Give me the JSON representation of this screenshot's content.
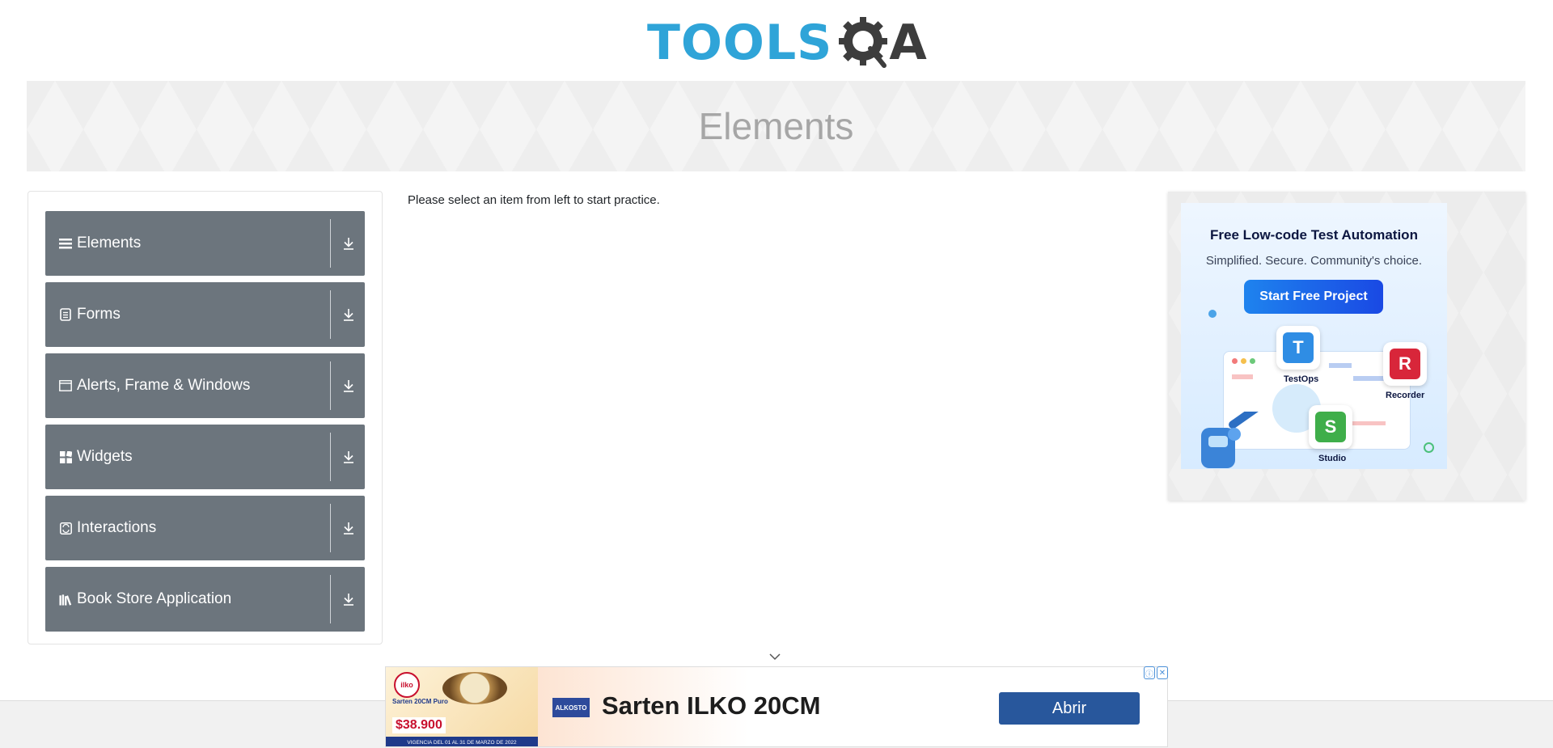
{
  "header": {
    "logo_tools": "TOOLS",
    "logo_a": "A",
    "page_title": "Elements"
  },
  "sidebar": {
    "groups": [
      {
        "label": "Elements",
        "icon": "list-icon"
      },
      {
        "label": "Forms",
        "icon": "form-icon"
      },
      {
        "label": "Alerts, Frame & Windows",
        "icon": "window-icon"
      },
      {
        "label": "Widgets",
        "icon": "widgets-icon"
      },
      {
        "label": "Interactions",
        "icon": "interaction-icon"
      },
      {
        "label": "Book Store Application",
        "icon": "books-icon"
      }
    ]
  },
  "main": {
    "instruction": "Please select an item from left to start practice."
  },
  "side_ad": {
    "title": "Free Low-code Test Automation",
    "subtitle": "Simplified. Secure. Community's choice.",
    "button": "Start Free Project",
    "products": [
      "TestOps",
      "Recorder",
      "Studio"
    ]
  },
  "bottom_ad": {
    "headline": "Sarten ILKO 20CM",
    "cta": "Abrir",
    "brand": "ALKOSTO",
    "product_brand": "ilko",
    "product_name": "Sarten 20CM Puro",
    "price": "$38.900",
    "validity": "VIGENCIA DEL 01 AL 31 DE MARZO DE 2022"
  },
  "colors": {
    "accent_blue": "#2fa4d8",
    "sidebar_group": "#6c757d",
    "cta_blue": "#28579c"
  }
}
